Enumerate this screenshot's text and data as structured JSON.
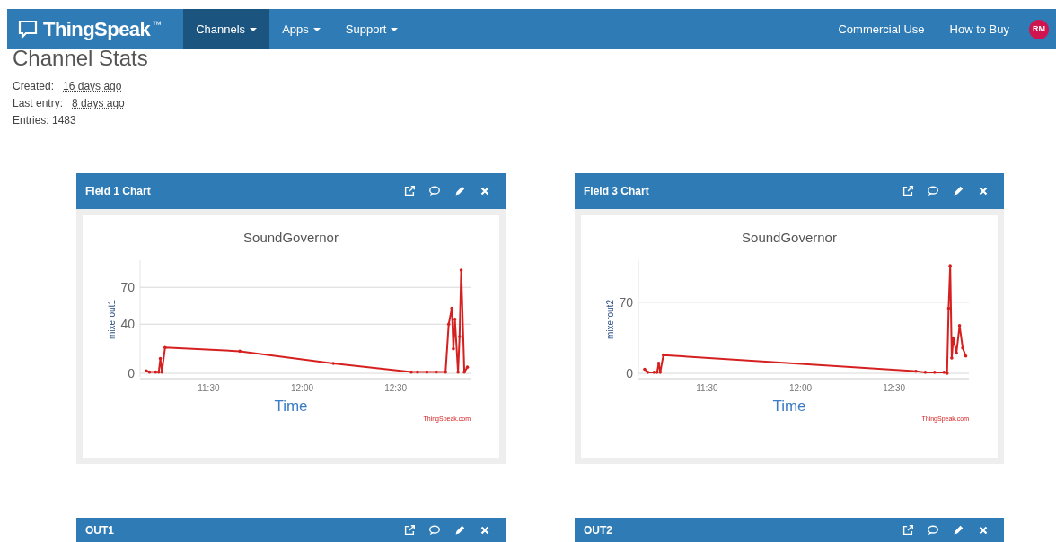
{
  "navbar": {
    "brand": "ThingSpeak",
    "trademark": "™",
    "items": [
      {
        "label": "Channels",
        "selected": true,
        "dropdown": true
      },
      {
        "label": "Apps",
        "selected": false,
        "dropdown": true
      },
      {
        "label": "Support",
        "selected": false,
        "dropdown": true
      }
    ],
    "right_items": [
      "Commercial Use",
      "How to Buy"
    ],
    "avatar": "RM"
  },
  "page_title": "Channel Stats",
  "stats": [
    {
      "label": "Created:",
      "value": "16 days ago"
    },
    {
      "label": "Last entry:",
      "value": "8 days ago"
    },
    {
      "label": "Entries: 1483"
    }
  ],
  "cards": [
    {
      "title": "Field 1 Chart",
      "credit": "ThingSpeak.com",
      "chart_data": {
        "type": "line",
        "title": "SoundGovernor",
        "xlabel": "Time",
        "ylabel": "mixerout1",
        "x": [
          670,
          671,
          673,
          674,
          674.5,
          675,
          676,
          700,
          730,
          755,
          757,
          760,
          763,
          766,
          767,
          768,
          768.5,
          769,
          770,
          770.5,
          771,
          772,
          773
        ],
        "series": [
          {
            "color": "#d62020",
            "values": [
              2,
              1,
              1,
              1,
              12,
              1,
              21,
              18,
              8,
              1,
              1,
              1,
              1,
              1,
              40,
              53,
              20,
              44,
              1,
              30,
              84,
              1,
              5
            ]
          }
        ],
        "xlim": [
          668,
          774
        ],
        "ylim": [
          -3,
          92
        ],
        "grid": true,
        "xticks": [
          {
            "value": 690,
            "label": "11:30"
          },
          {
            "value": 720,
            "label": "12:00"
          },
          {
            "value": 750,
            "label": "12:30"
          }
        ],
        "yticks": [
          0,
          40,
          70
        ]
      }
    },
    {
      "title": "Field 3 Chart",
      "credit": "ThingSpeak.com",
      "chart_data": {
        "type": "line",
        "title": "SoundGovernor",
        "xlabel": "Time",
        "ylabel": "mixerout2",
        "x": [
          670,
          671,
          673,
          674,
          674.5,
          675,
          676,
          757,
          760,
          763,
          766,
          767,
          767.5,
          768,
          768.5,
          769,
          770,
          771,
          772,
          773
        ],
        "series": [
          {
            "color": "#d62020",
            "values": [
              4,
              1,
              1,
              1,
              10,
              1,
              18,
              2,
              1,
              1,
              1,
              0,
              64,
              106,
              15,
              35,
              20,
              47,
              25,
              17
            ]
          }
        ],
        "xlim": [
          668,
          774
        ],
        "ylim": [
          -3,
          112
        ],
        "grid": true,
        "xticks": [
          {
            "value": 690,
            "label": "11:30"
          },
          {
            "value": 720,
            "label": "12:00"
          },
          {
            "value": 750,
            "label": "12:30"
          }
        ],
        "yticks": [
          0,
          70
        ]
      }
    },
    {
      "title": "OUT1"
    },
    {
      "title": "OUT2"
    }
  ]
}
